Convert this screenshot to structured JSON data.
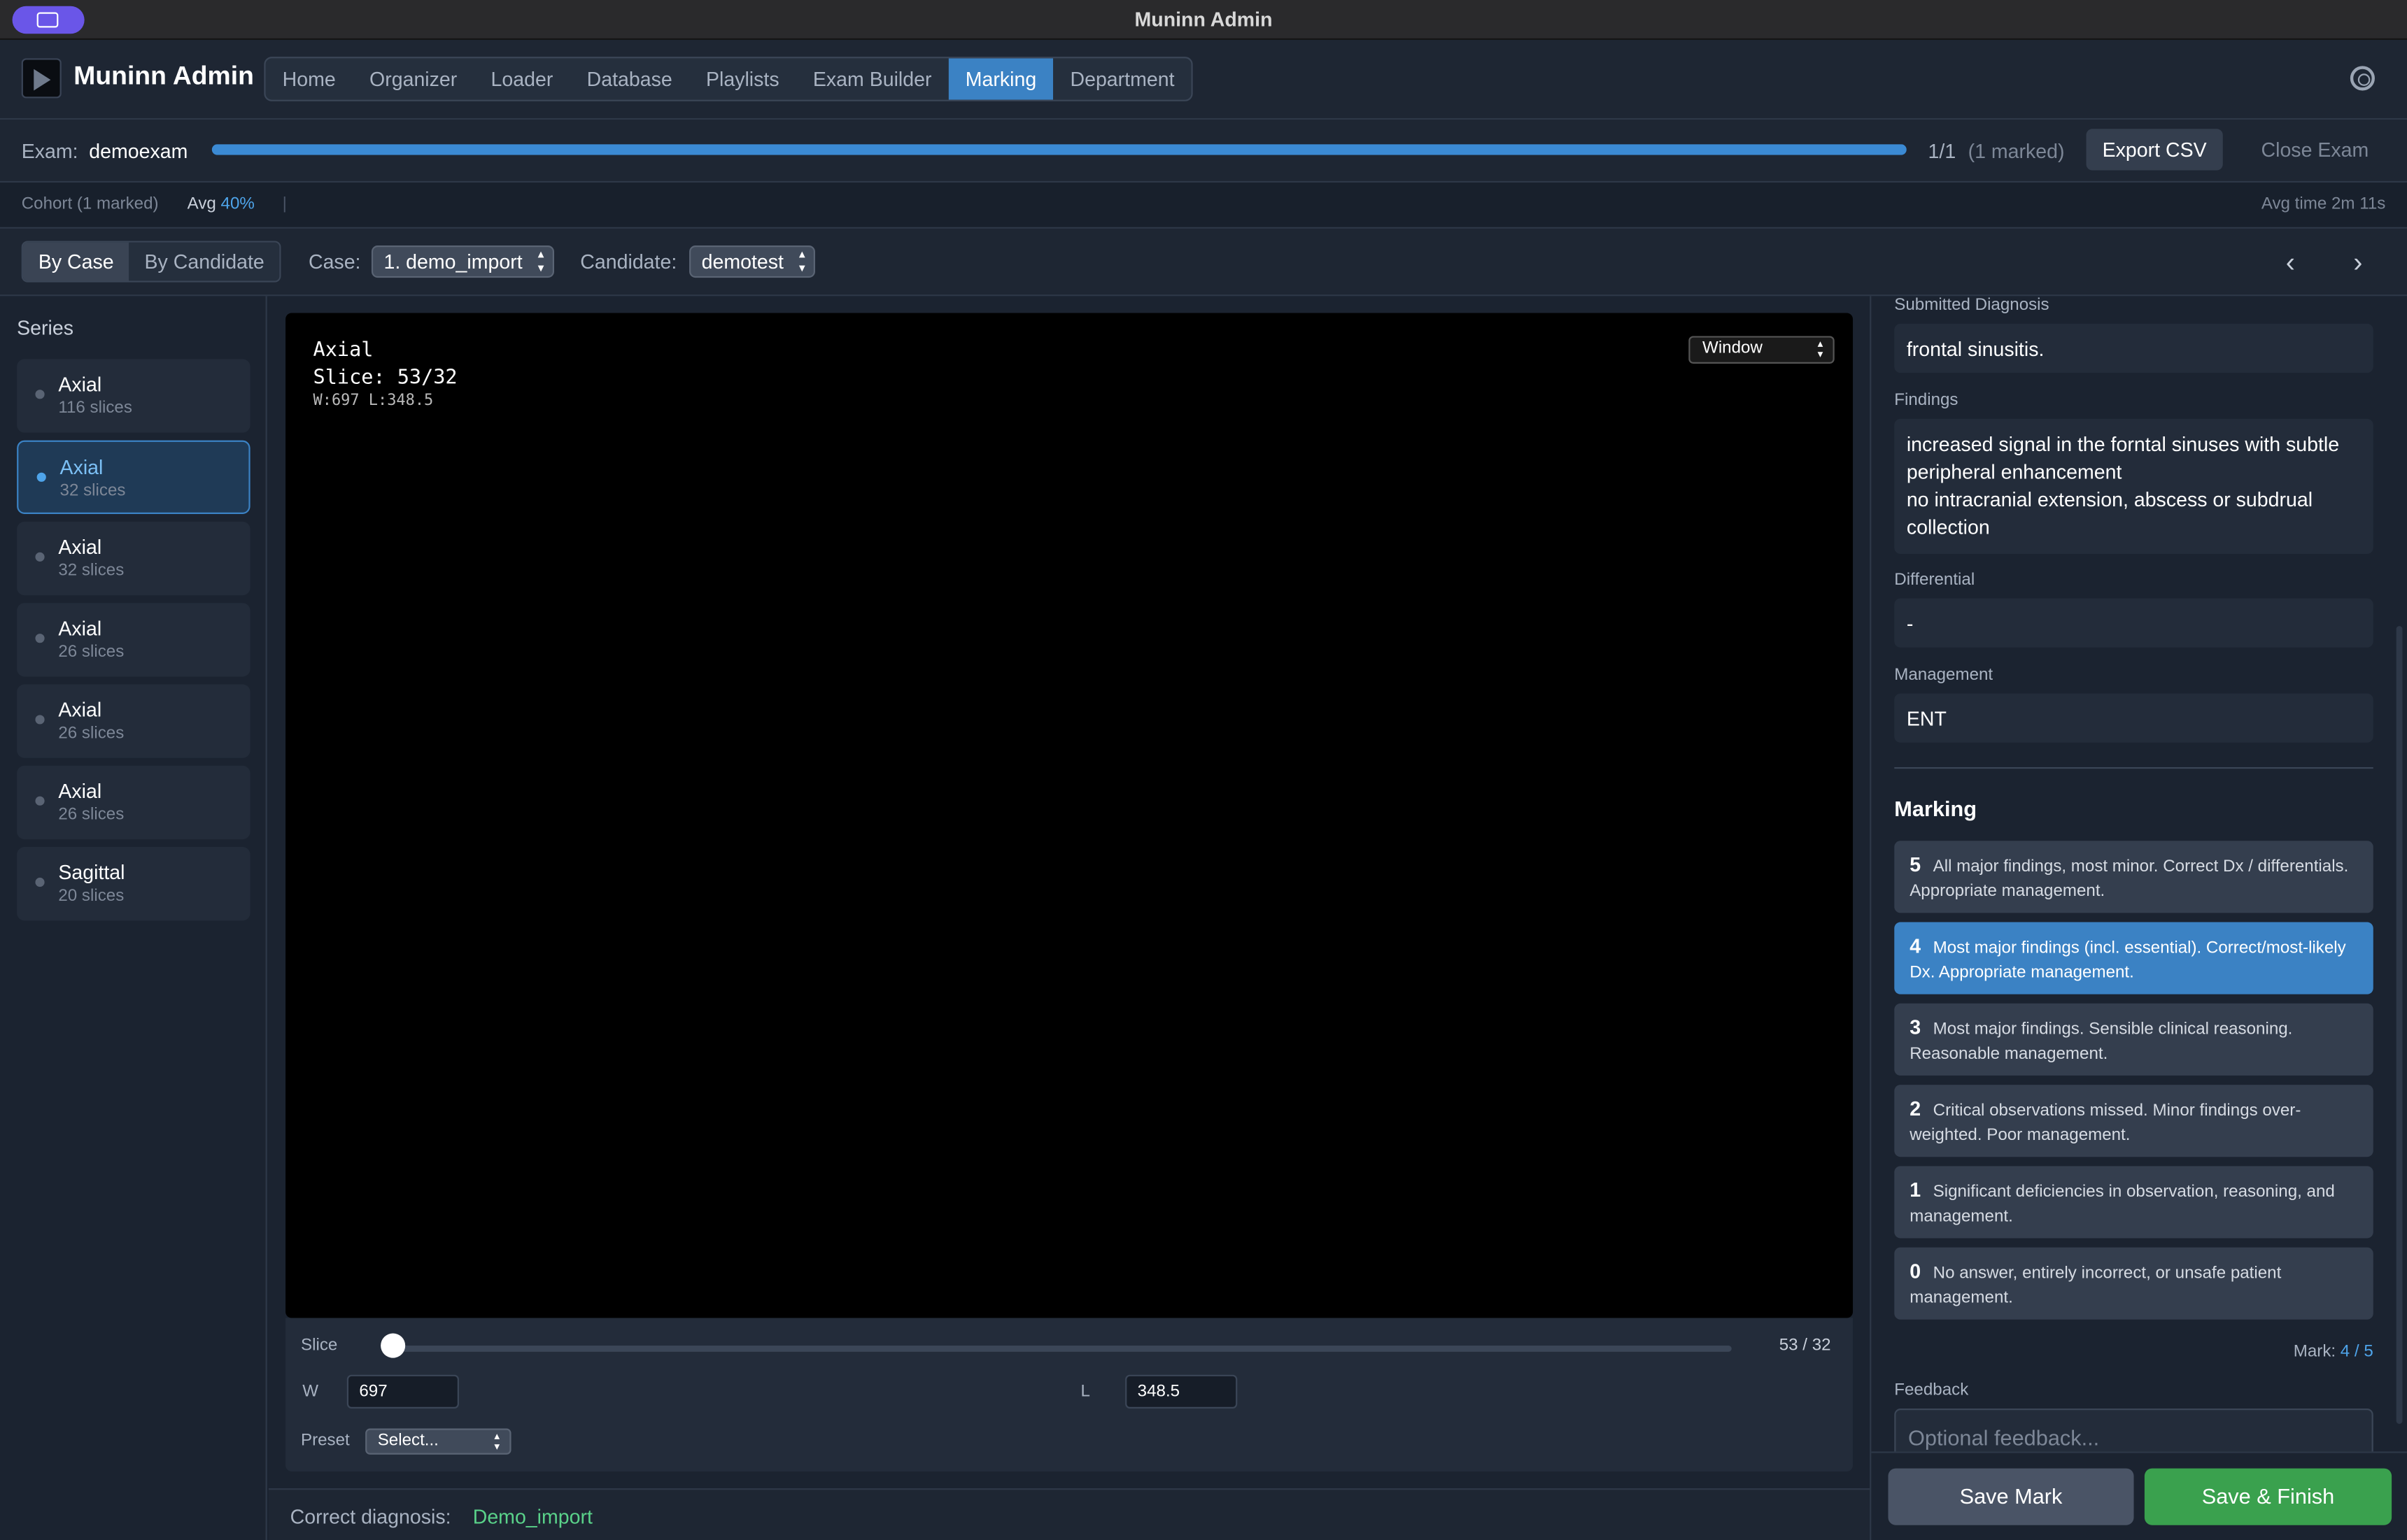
{
  "window": {
    "title": "Muninn Admin"
  },
  "nav": {
    "brand": "Muninn Admin",
    "tabs": [
      "Home",
      "Organizer",
      "Loader",
      "Database",
      "Playlists",
      "Exam Builder",
      "Marking",
      "Department"
    ],
    "active_tab": "Marking"
  },
  "exam": {
    "label": "Exam:",
    "name": "demoexam",
    "progress": 1.0,
    "count": "1/1",
    "marked": "(1 marked)",
    "export_label": "Export CSV",
    "close_label": "Close Exam"
  },
  "cohort": {
    "text": "Cohort (1 marked)",
    "avg_label": "Avg",
    "avg_value": "40%",
    "separator": "|",
    "avg_time": "Avg time 2m 11s"
  },
  "filters": {
    "by_case": "By Case",
    "by_candidate": "By Candidate",
    "case_label": "Case:",
    "case_value": "1. demo_import",
    "candidate_label": "Candidate:",
    "candidate_value": "demotest",
    "prev": "‹",
    "next": "›"
  },
  "series": {
    "title": "Series",
    "items": [
      {
        "name": "Axial",
        "slices": "116 slices"
      },
      {
        "name": "Axial",
        "slices": "32 slices"
      },
      {
        "name": "Axial",
        "slices": "32 slices"
      },
      {
        "name": "Axial",
        "slices": "26 slices"
      },
      {
        "name": "Axial",
        "slices": "26 slices"
      },
      {
        "name": "Axial",
        "slices": "26 slices"
      },
      {
        "name": "Sagittal",
        "slices": "20 slices"
      }
    ],
    "selected_index": 1
  },
  "viewer": {
    "plane": "Axial",
    "slice_text": "Slice: 53/32",
    "wl_text": "W:697 L:348.5",
    "window_select": "Window"
  },
  "controls": {
    "slice_label": "Slice",
    "slice_value": "53 / 32",
    "w_label": "W",
    "w_value": "697",
    "l_label": "L",
    "l_value": "348.5",
    "preset_label": "Preset",
    "preset_value": "Select..."
  },
  "correct": {
    "label": "Correct diagnosis:",
    "value": "Demo_import"
  },
  "answer": {
    "diagnosis_label": "Submitted Diagnosis",
    "diagnosis": "frontal sinusitis.",
    "findings_label": "Findings",
    "findings_line1": "increased signal in the forntal sinuses with subtle peripheral enhancement",
    "findings_line2": "no intracranial extension, abscess or subdrual collection",
    "differential_label": "Differential",
    "differential": "-",
    "management_label": "Management",
    "management": "ENT"
  },
  "marking": {
    "title": "Marking",
    "options": [
      {
        "score": "5",
        "text": "All major findings, most minor. Correct Dx / differentials. Appropriate management."
      },
      {
        "score": "4",
        "text": "Most major findings (incl. essential). Correct/most-likely Dx. Appropriate management."
      },
      {
        "score": "3",
        "text": "Most major findings. Sensible clinical reasoning. Reasonable management."
      },
      {
        "score": "2",
        "text": "Critical observations missed. Minor findings over-weighted. Poor management."
      },
      {
        "score": "1",
        "text": "Significant deficiencies in observation, reasoning, and management."
      },
      {
        "score": "0",
        "text": "No answer, entirely incorrect, or unsafe patient management."
      }
    ],
    "selected_score": "4",
    "mark_label": "Mark:",
    "mark_value": "4 / 5",
    "feedback_label": "Feedback",
    "feedback_placeholder": "Optional feedback...",
    "save_label": "Save Mark",
    "finish_label": "Save & Finish"
  },
  "colors": {
    "accent": "#3b82c4",
    "success": "#3aa14e",
    "correct_text": "#5ad28a"
  }
}
